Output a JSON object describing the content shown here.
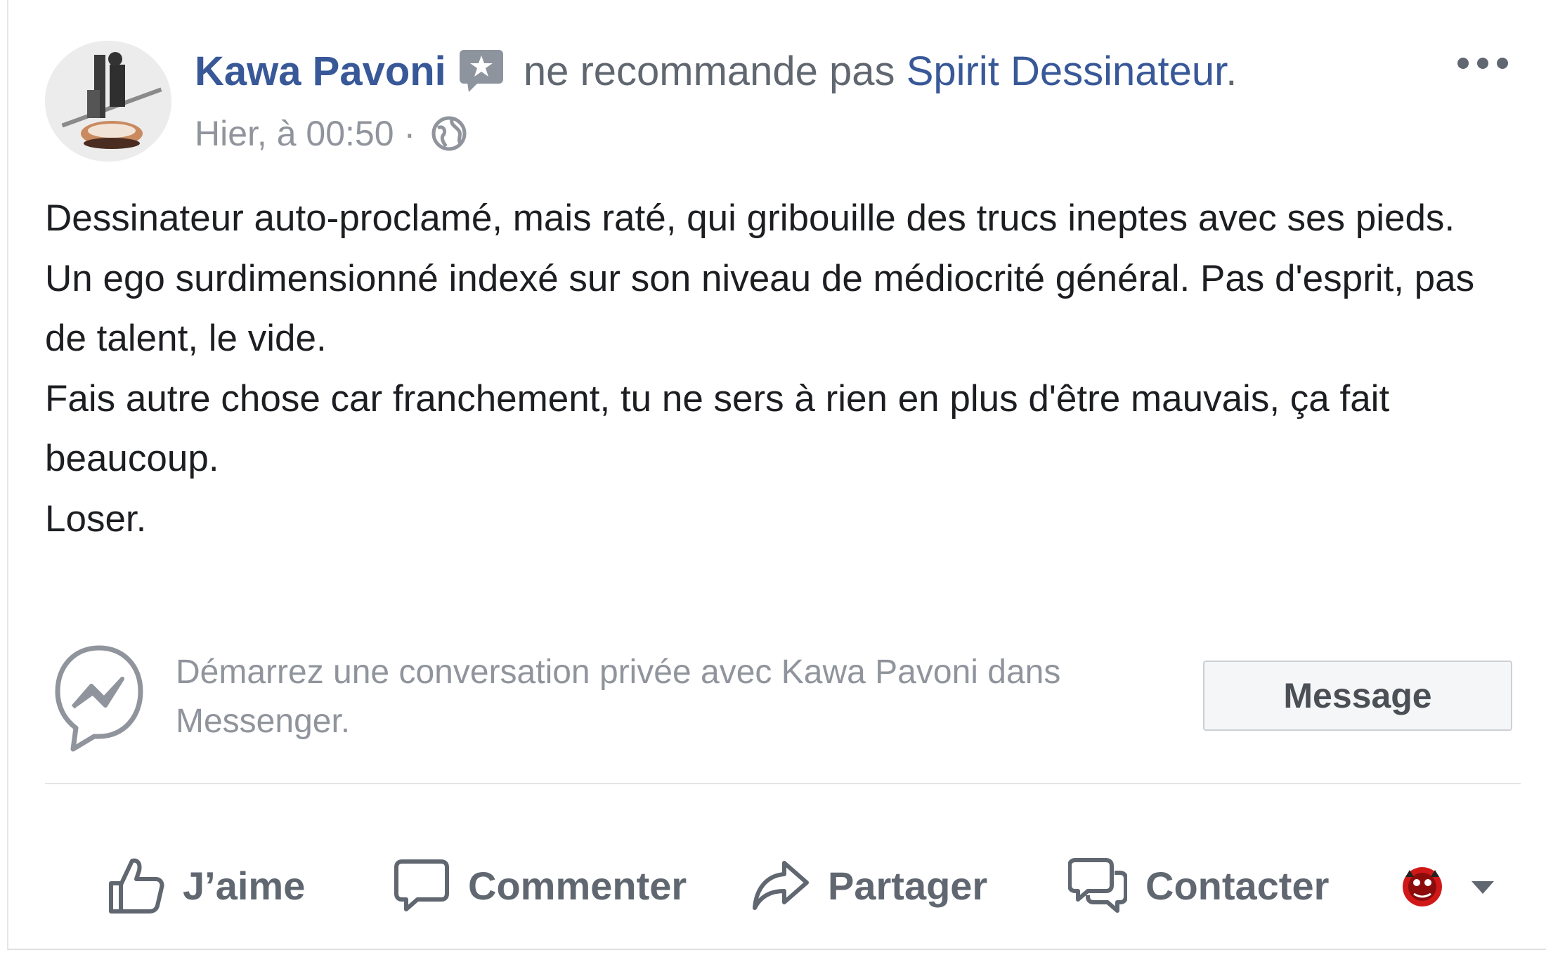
{
  "post": {
    "author": "Kawa Pavoni",
    "verb": "ne recommande pas",
    "page": "Spirit Dessinateur",
    "page_end": ".",
    "timestamp": "Hier, à 00:50",
    "separator": "·",
    "audience_icon": "globe-icon",
    "more_icon": "ellipsis-icon",
    "badge_icon": "recommendation-star-icon",
    "body": [
      "Dessinateur auto-proclamé, mais raté, qui gribouille des trucs ineptes avec ses pieds.",
      "Un ego surdimensionné indexé sur son niveau de médiocrité général. Pas d'esprit, pas de talent, le vide.",
      "Fais autre chose car franchement, tu ne sers à rien en plus d'être mauvais, ça fait beaucoup.",
      "Loser."
    ]
  },
  "messenger": {
    "icon": "messenger-icon",
    "prompt": "Démarrez une conversation privée avec Kawa Pavoni dans Messenger.",
    "button_label": "Message"
  },
  "actions": {
    "like_label": "J’aime",
    "comment_label": "Commenter",
    "share_label": "Partager",
    "contact_label": "Contacter",
    "like_icon": "thumbs-up-icon",
    "comment_icon": "comment-bubble-icon",
    "share_icon": "share-arrow-icon",
    "contact_icon": "chat-bubbles-icon",
    "reaction_icon": "page-avatar-icon",
    "dropdown_icon": "caret-down-icon"
  },
  "colors": {
    "link": "#385898",
    "text": "#1c1e21",
    "secondary": "#90949c",
    "action": "#606770",
    "button_bg": "#f5f6f7",
    "button_border": "#ccd0d5"
  }
}
